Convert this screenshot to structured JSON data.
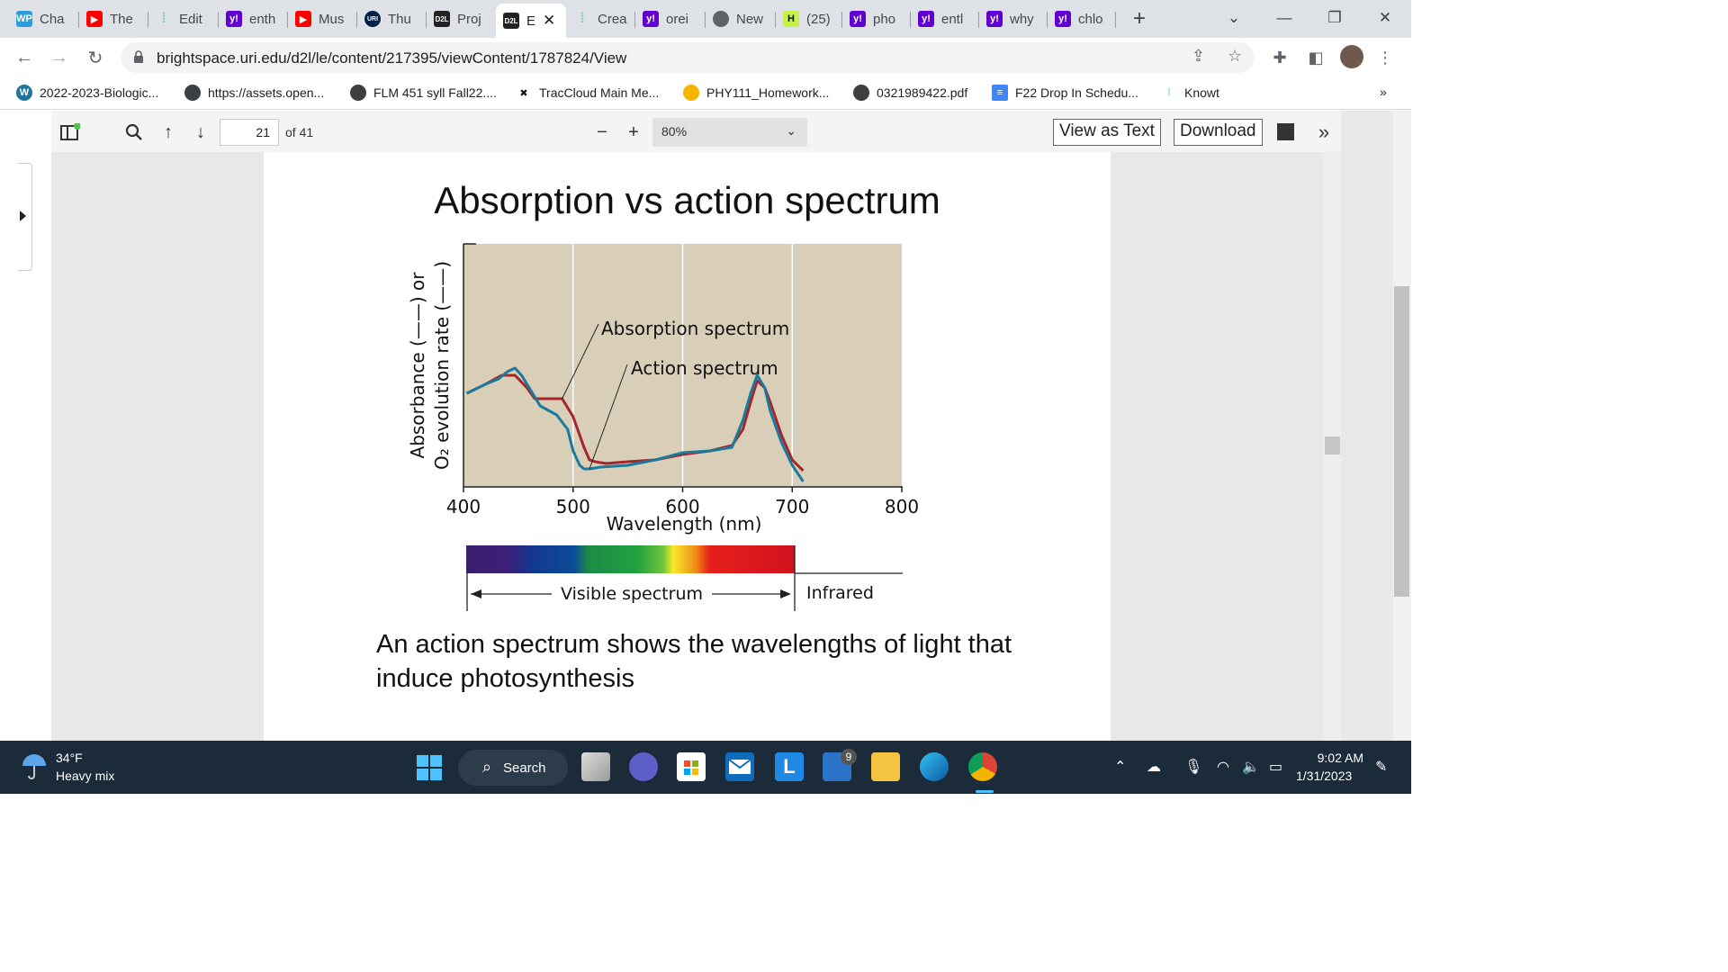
{
  "browser": {
    "tabs": [
      {
        "label": "Cha",
        "icon": "wp-icon",
        "color": "#2d9cdb"
      },
      {
        "label": "The",
        "icon": "youtube-icon",
        "color": "#ff0000"
      },
      {
        "label": "Edit",
        "icon": "knowt-icon",
        "color": "#7ed3c2"
      },
      {
        "label": "enth",
        "icon": "yahoo-icon",
        "color": "#6001d2"
      },
      {
        "label": "Mus",
        "icon": "youtube-icon",
        "color": "#ff0000"
      },
      {
        "label": "Thu",
        "icon": "uri-icon",
        "color": "#002147"
      },
      {
        "label": "Proj",
        "icon": "d2l-icon",
        "color": "#222222"
      },
      {
        "label": "E",
        "icon": "d2l-icon",
        "color": "#222222"
      },
      {
        "label": "Crea",
        "icon": "knowt-icon",
        "color": "#7ed3c2"
      },
      {
        "label": "orei",
        "icon": "yahoo-icon",
        "color": "#6001d2"
      },
      {
        "label": "New",
        "icon": "globe-icon",
        "color": "#5f6368"
      },
      {
        "label": "(25)",
        "icon": "h-icon",
        "color": "#c8f04b"
      },
      {
        "label": "pho",
        "icon": "yahoo-icon",
        "color": "#6001d2"
      },
      {
        "label": "entl",
        "icon": "yahoo-icon",
        "color": "#6001d2"
      },
      {
        "label": "why",
        "icon": "yahoo-icon",
        "color": "#6001d2"
      },
      {
        "label": "chlo",
        "icon": "yahoo-icon",
        "color": "#6001d2"
      }
    ],
    "url": "brightspace.uri.edu/d2l/le/content/217395/viewContent/1787824/View",
    "bookmarks": [
      {
        "label": "2022-2023-Biologic...",
        "icon": "wordpress-icon"
      },
      {
        "label": "https://assets.open...",
        "icon": "globe-icon"
      },
      {
        "label": "FLM 451 syll Fall22....",
        "icon": "globe-icon"
      },
      {
        "label": "TracCloud Main Me...",
        "icon": "traccloud-icon"
      },
      {
        "label": "PHY111_Homework...",
        "icon": "phy-icon"
      },
      {
        "label": "0321989422.pdf",
        "icon": "globe-icon"
      },
      {
        "label": "F22 Drop In Schedu...",
        "icon": "docs-icon"
      },
      {
        "label": "Knowt",
        "icon": "knowt-icon"
      }
    ],
    "more_bookmarks": "»"
  },
  "pdf_toolbar": {
    "page_number": "21",
    "page_count": "of 41",
    "zoom": "80%",
    "view_as_text": "View as Text",
    "download": "Download",
    "more": "»"
  },
  "slide": {
    "title": "Absorption vs action spectrum",
    "caption": "An action spectrum shows the wavelengths of light that induce photosynthesis"
  },
  "chart_data": {
    "type": "line",
    "xlabel": "Wavelength (nm)",
    "ylabel_line1": "Absorbance (——) or",
    "ylabel_line2": "O₂ evolution rate (——)",
    "xlim": [
      400,
      800
    ],
    "xticks": [
      "400",
      "500",
      "600",
      "700",
      "800"
    ],
    "grid": "vertical at 500, 600, 700",
    "series": [
      {
        "name": "Absorption spectrum",
        "color": "#a8242b",
        "x": [
          403,
          420,
          435,
          447,
          458,
          465,
          472,
          480,
          490,
          500,
          510,
          515,
          520,
          530,
          550,
          575,
          600,
          625,
          645,
          655,
          662,
          668,
          675,
          680,
          690,
          700,
          710
        ],
        "y": [
          0.45,
          0.5,
          0.55,
          0.55,
          0.48,
          0.42,
          0.42,
          0.42,
          0.42,
          0.32,
          0.15,
          0.08,
          0.07,
          0.06,
          0.07,
          0.08,
          0.11,
          0.13,
          0.16,
          0.25,
          0.4,
          0.52,
          0.48,
          0.4,
          0.22,
          0.08,
          0.02
        ]
      },
      {
        "name": "Action spectrum",
        "color": "#1a7a9b",
        "x": [
          403,
          420,
          432,
          440,
          447,
          453,
          460,
          470,
          485,
          495,
          500,
          506,
          510,
          515,
          525,
          550,
          575,
          600,
          625,
          645,
          655,
          662,
          668,
          675,
          680,
          690,
          700,
          710
        ],
        "y": [
          0.45,
          0.5,
          0.53,
          0.57,
          0.59,
          0.55,
          0.48,
          0.38,
          0.33,
          0.25,
          0.13,
          0.05,
          0.03,
          0.03,
          0.04,
          0.05,
          0.08,
          0.12,
          0.13,
          0.15,
          0.3,
          0.45,
          0.55,
          0.48,
          0.35,
          0.18,
          0.05,
          -0.04
        ]
      }
    ],
    "annotations": [
      "Absorption spectrum",
      "Action spectrum"
    ],
    "spectrum_bar": {
      "visible_label": "Visible spectrum",
      "infrared_label": "Infrared"
    }
  },
  "taskbar": {
    "temperature": "34°F",
    "weather": "Heavy mix",
    "search": "Search",
    "time": "9:02 AM",
    "date": "1/31/2023",
    "notification_count": "9"
  }
}
